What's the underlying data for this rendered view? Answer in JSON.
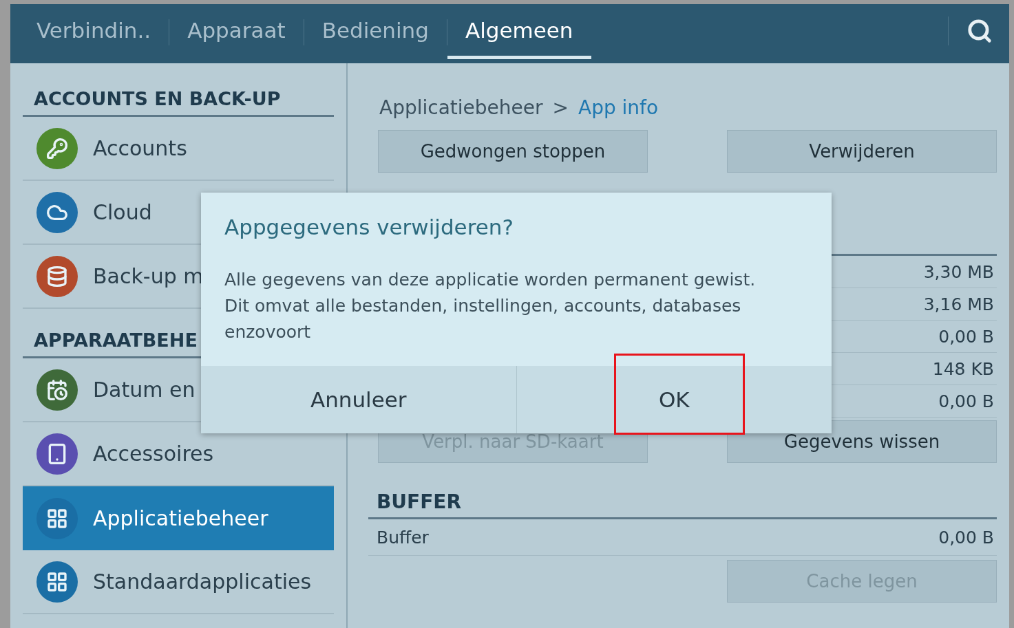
{
  "tabs": [
    {
      "label": "Verbindin..",
      "selected": false
    },
    {
      "label": "Apparaat",
      "selected": false
    },
    {
      "label": "Bediening",
      "selected": false
    },
    {
      "label": "Algemeen",
      "selected": true
    }
  ],
  "sidebar": {
    "sections": [
      {
        "title": "ACCOUNTS EN BACK-UP",
        "items": [
          {
            "label": "Accounts",
            "kind": "key",
            "color": "#4f8a2e",
            "selected": false
          },
          {
            "label": "Cloud",
            "kind": "cloud",
            "color": "#1f6fa8",
            "selected": false
          },
          {
            "label": "Back-up m",
            "kind": "database",
            "color": "#b24a2c",
            "selected": false
          }
        ]
      },
      {
        "title": "APPARAATBEHE",
        "items": [
          {
            "label": "Datum en",
            "kind": "calendar",
            "color": "#3f6a3a",
            "selected": false
          },
          {
            "label": "Accessoires",
            "kind": "tablet",
            "color": "#5a4fb0",
            "selected": false
          },
          {
            "label": "Applicatiebeheer",
            "kind": "grid",
            "color": "#1a6ea5",
            "selected": true
          },
          {
            "label": "Standaardapplicaties",
            "kind": "grid",
            "color": "#1a6ea5",
            "selected": false
          }
        ]
      }
    ]
  },
  "breadcrumb": {
    "parent": "Applicatiebeheer",
    "separator": ">",
    "current": "App info"
  },
  "top_buttons": [
    {
      "label": "Gedwongen stoppen",
      "disabled": false
    },
    {
      "label": "Verwijderen",
      "disabled": false
    }
  ],
  "storage_values": [
    "3,30 MB",
    "3,16 MB",
    "0,00 B",
    "148 KB",
    "0,00 B"
  ],
  "storage_buttons": [
    {
      "label": "Verpl. naar SD-kaart",
      "disabled": true
    },
    {
      "label": "Gegevens wissen",
      "disabled": false
    }
  ],
  "buffer": {
    "title": "BUFFER",
    "rows": [
      {
        "label": "Buffer",
        "value": "0,00 B"
      }
    ],
    "button": {
      "label": "Cache legen",
      "disabled": true
    }
  },
  "dialog": {
    "title": "Appgegevens verwijderen?",
    "message": "Alle gegevens van deze applicatie worden permanent gewist. Dit omvat alle bestanden, instellingen, accounts, databases enzovoort",
    "buttons": [
      {
        "label": "Annuleer",
        "highlighted": false
      },
      {
        "label": "OK",
        "highlighted": true
      }
    ]
  }
}
